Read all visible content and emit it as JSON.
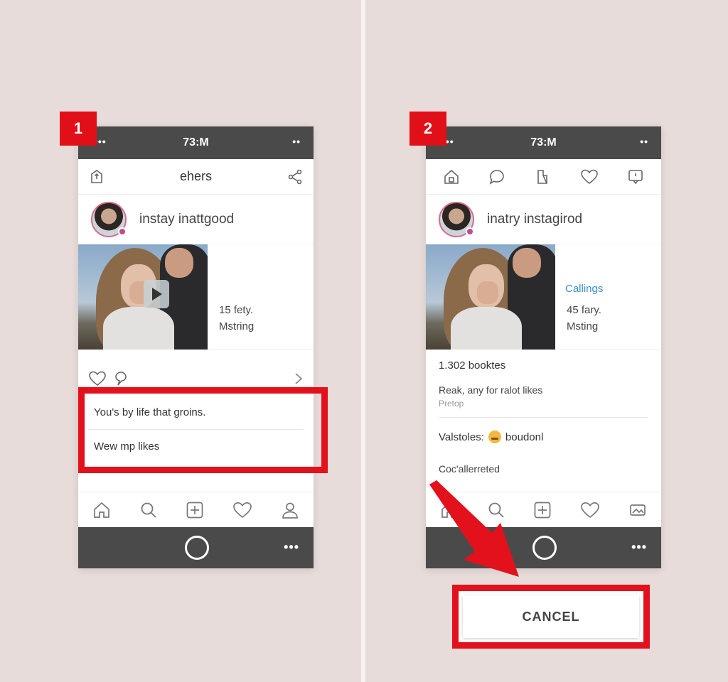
{
  "step1": {
    "badge": "1",
    "status_time": "73:M",
    "status_left": "•••",
    "status_right": "••",
    "title": "ehers",
    "profile_name": "instay inattgood",
    "post_meta1": "15 fety.",
    "post_meta2": "Mstring",
    "comment1": "You's by life that groins.",
    "comment2": "Wew mp likes",
    "home_dots": "•••"
  },
  "step2": {
    "badge": "2",
    "status_time": "73:M",
    "status_left": "•••",
    "status_right": "••",
    "profile_name": "inatry instagirod",
    "post_link": "Callings",
    "post_meta1": "45 fary.",
    "post_meta2": "Msting",
    "likes": "1.302 booktes",
    "reply": "Reak, any for ralot likes",
    "reply_small": "Pretop",
    "val_label": "Valstoles:",
    "val_value": "boudonl",
    "collected": "Coc'allerreted",
    "home_dots": "•••",
    "cancel_label": "CANCEL"
  },
  "colors": {
    "accent_red": "#e3111b",
    "bar_dark": "#4a4a4a",
    "link_blue": "#3a8ed0",
    "background": "#e7dcda"
  },
  "icons": {
    "top_left_1": "share-box-icon",
    "top_right_1": "share-icon",
    "top_2": [
      "home-icon",
      "chat-icon",
      "bookmark-icon",
      "heart-icon",
      "message-icon"
    ],
    "bottom": [
      "home-icon",
      "search-icon",
      "add-icon",
      "heart-icon",
      "profile-icon"
    ]
  }
}
